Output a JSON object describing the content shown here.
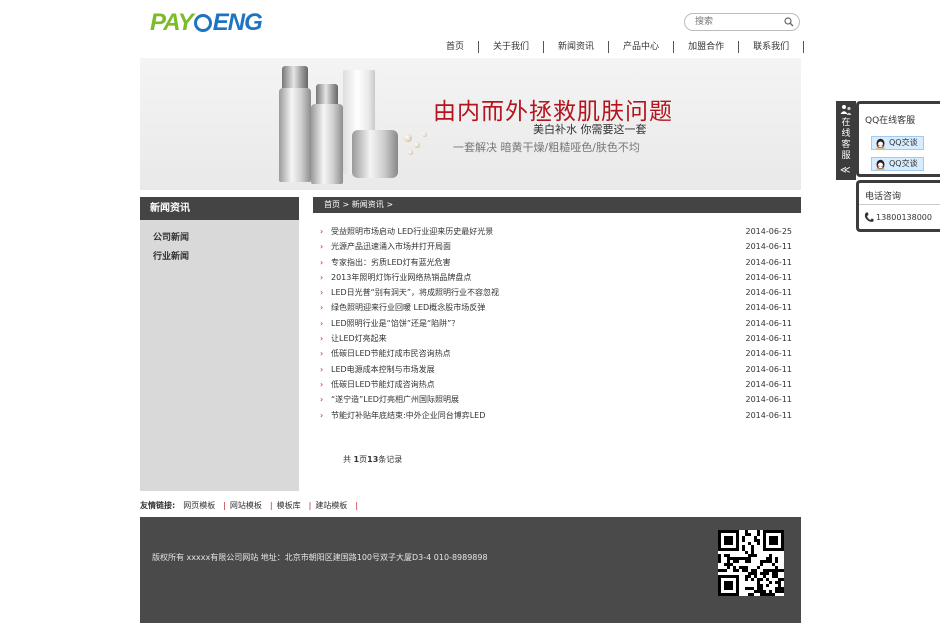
{
  "header": {
    "logo_pay": "PAY",
    "logo_eng": "ENG",
    "search_placeholder": "搜索"
  },
  "nav": [
    "首页",
    "关于我们",
    "新闻资讯",
    "产品中心",
    "加盟合作",
    "联系我们"
  ],
  "banner": {
    "headline": "由内而外拯救肌肤问题",
    "sub1": "美白补水  你需要这一套",
    "sub2": "一套解决 暗黄干燥/粗糙哑色/肤色不均"
  },
  "sidebar": {
    "title": "新闻资讯",
    "items": [
      "公司新闻",
      "行业新闻"
    ]
  },
  "breadcrumb": {
    "home": "首页",
    "sep": ">",
    "current": "新闻资讯",
    "tail": ">"
  },
  "news": [
    {
      "title": "受益照明市场启动 LED行业迎来历史最好光景",
      "date": "2014-06-25"
    },
    {
      "title": "光源产品迅速涌入市场并打开局面",
      "date": "2014-06-11"
    },
    {
      "title": "专家指出：劣质LED灯有蓝光危害",
      "date": "2014-06-11"
    },
    {
      "title": "2013年照明灯饰行业网络热销品牌盘点",
      "date": "2014-06-11"
    },
    {
      "title": "LED日光普“别有洞天”，将成照明行业不容忽视",
      "date": "2014-06-11"
    },
    {
      "title": "绿色照明迎来行业回暖 LED概念股市场反弹",
      "date": "2014-06-11"
    },
    {
      "title": "LED照明行业是“馅饼”还是“陷阱”？",
      "date": "2014-06-11"
    },
    {
      "title": "让LED灯亮起来",
      "date": "2014-06-11"
    },
    {
      "title": "低碳日LED节能灯成市民咨询热点",
      "date": "2014-06-11"
    },
    {
      "title": "LED电源成本控制与市场发展",
      "date": "2014-06-11"
    },
    {
      "title": "低碳日LED节能灯成咨询热点",
      "date": "2014-06-11"
    },
    {
      "title": "“遂宁造”LED灯亮相广州国际照明展",
      "date": "2014-06-11"
    },
    {
      "title": "节能灯补贴年底结束:中外企业同台博弈LED",
      "date": "2014-06-11"
    }
  ],
  "pager": {
    "prefix": "共",
    "pages": "1",
    "mid": "页",
    "count": "13",
    "suffix": "条记录"
  },
  "links": {
    "label": "友情链接:",
    "items": [
      "网页模板",
      "网站模板",
      "模板库",
      "建站模板"
    ],
    "sep": "|"
  },
  "footer": {
    "text": "版权所有 xxxxx有限公司网站 地址：北京市朝阳区建国路100号双子大厦D3-4 010-8989898"
  },
  "float_panel": {
    "tab_text": [
      "在",
      "线",
      "客",
      "服"
    ],
    "collapse": "≪",
    "qq_title": "QQ在线客服",
    "qq_buttons": [
      "QQ交谈",
      "QQ交谈"
    ],
    "phone_title": "电话咨询",
    "phone_number": "13800138000"
  },
  "colors": {
    "logo_green": "#7cbb2a",
    "logo_blue": "#1f74c1",
    "accent_red": "#c0161f",
    "dark_bar": "#444444"
  }
}
